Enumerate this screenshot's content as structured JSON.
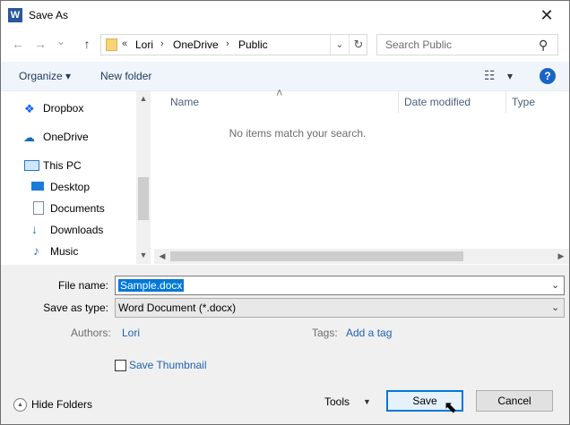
{
  "window": {
    "title": "Save As",
    "app_icon_letter": "W",
    "close_glyph": "✕"
  },
  "navigation": {
    "back_glyph": "←",
    "forward_glyph": "→",
    "dropdown_glyph": "⌄",
    "up_glyph": "↑"
  },
  "address_bar": {
    "prefix": "«",
    "segments": [
      "Lori",
      "OneDrive",
      "Public"
    ],
    "separator": "›",
    "dropdown_glyph": "⌄",
    "refresh_glyph": "↻"
  },
  "search": {
    "placeholder": "Search Public",
    "icon_glyph": "⚲"
  },
  "toolbar": {
    "organize_label": "Organize ▾",
    "new_folder_label": "New folder",
    "view_glyph": "☷",
    "view_dropdown_glyph": "▾",
    "help_glyph": "?"
  },
  "sidebar": {
    "items": [
      {
        "label": "Dropbox",
        "icon": "dropbox-icon",
        "color": "#0061fe"
      },
      {
        "label": "OneDrive",
        "icon": "cloud-icon",
        "color": "#0f6cbd"
      },
      {
        "label": "This PC",
        "icon": "computer-icon",
        "color": "#2a76c9"
      },
      {
        "label": "Desktop",
        "icon": "desktop-icon",
        "color": "#1d7ad6"
      },
      {
        "label": "Documents",
        "icon": "document-icon",
        "color": "#7a8a99"
      },
      {
        "label": "Downloads",
        "icon": "download-icon",
        "color": "#2a76c9"
      },
      {
        "label": "Music",
        "icon": "music-icon",
        "color": "#2a76c9"
      }
    ],
    "scroll_up_glyph": "▲",
    "scroll_down_glyph": "▼"
  },
  "file_list": {
    "sort_glyph": "˄",
    "columns": [
      "Name",
      "Date modified",
      "Type"
    ],
    "empty_message": "No items match your search.",
    "scroll_left_glyph": "◀",
    "scroll_right_glyph": "▶"
  },
  "form": {
    "file_name_label": "File name:",
    "file_name_value": "Sample.docx",
    "save_as_type_label": "Save as type:",
    "save_as_type_value": "Word Document (*.docx)",
    "dropdown_glyph": "⌄",
    "authors_label": "Authors:",
    "authors_value": "Lori",
    "tags_label": "Tags:",
    "tags_value": "Add a tag",
    "thumbnail_label": "Save Thumbnail",
    "thumbnail_checked": false
  },
  "footer": {
    "hide_folders_label": "Hide Folders",
    "hide_folders_glyph": "▲",
    "tools_label": "Tools",
    "tools_glyph": "▼",
    "save_label": "Save",
    "cancel_label": "Cancel",
    "cursor_glyph": "⬉"
  },
  "colors": {
    "accent": "#0078d7",
    "link": "#1e62b3",
    "toolbar_bg": "#f0f5fb",
    "panel_bg": "#f0f0f0"
  }
}
